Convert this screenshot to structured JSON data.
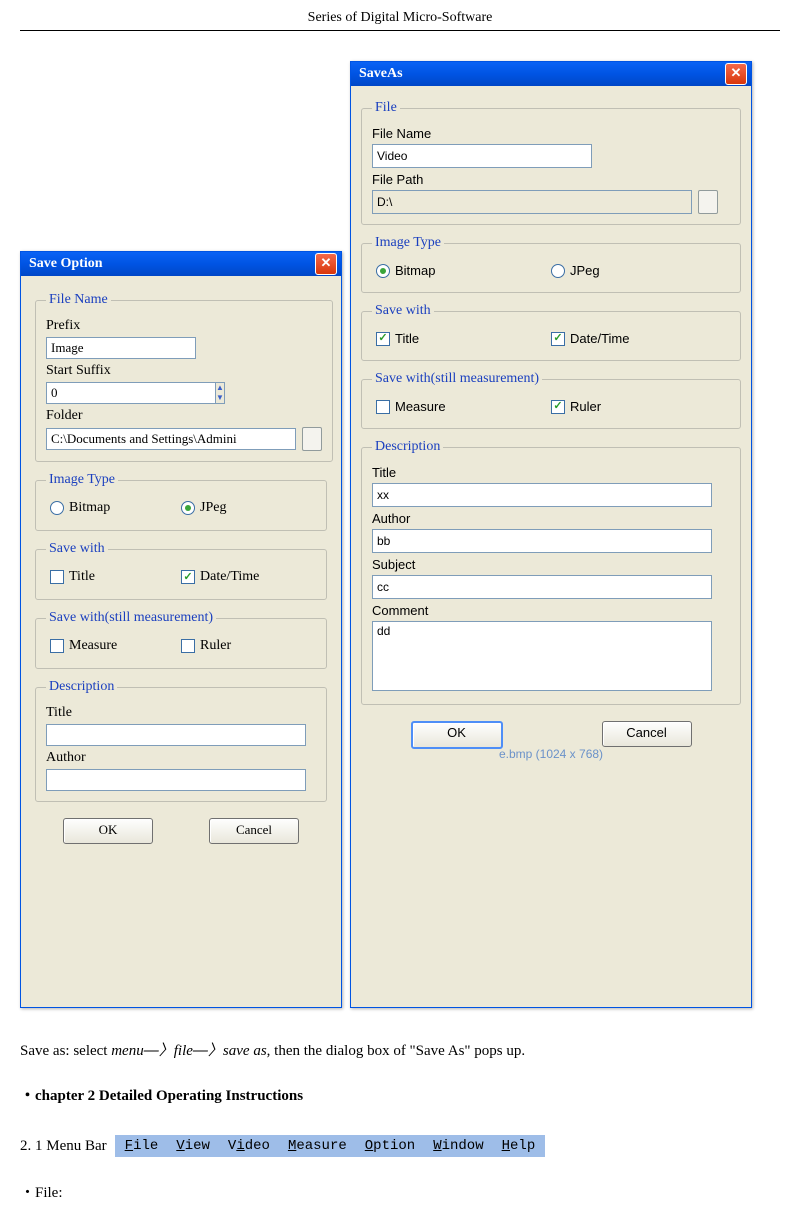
{
  "header": "Series of Digital Micro-Software",
  "dialog1": {
    "title": "Save Option",
    "file_name_group": "File Name",
    "prefix_label": "Prefix",
    "prefix_value": "Image",
    "start_suffix_label": "Start Suffix",
    "start_suffix_value": "0",
    "folder_label": "Folder",
    "folder_value": "C:\\Documents and Settings\\Admini",
    "image_type_group": "Image Type",
    "bitmap_label": "Bitmap",
    "jpeg_label": "JPeg",
    "save_with_group": "Save with",
    "title_check_label": "Title",
    "datetime_check_label": "Date/Time",
    "save_with_still_group": "Save with(still measurement)",
    "measure_label": "Measure",
    "ruler_label": "Ruler",
    "description_group": "Description",
    "desc_title_label": "Title",
    "desc_title_value": "",
    "desc_author_label": "Author",
    "desc_author_value": "",
    "ok": "OK",
    "cancel": "Cancel"
  },
  "dialog2": {
    "title": "SaveAs",
    "file_group": "File",
    "file_name_label": "File Name",
    "file_name_value": "Video",
    "file_path_label": "File Path",
    "file_path_value": "D:\\",
    "image_type_group": "Image Type",
    "bitmap_label": "Bitmap",
    "jpeg_label": "JPeg",
    "save_with_group": "Save with",
    "title_check_label": "Title",
    "datetime_check_label": "Date/Time",
    "save_with_still_group": "Save with(still measurement)",
    "measure_label": "Measure",
    "ruler_label": "Ruler",
    "description_group": "Description",
    "desc_title_label": "Title",
    "desc_title_value": "xx",
    "desc_author_label": "Author",
    "desc_author_value": "bb",
    "desc_subject_label": "Subject",
    "desc_subject_value": "cc",
    "desc_comment_label": "Comment",
    "desc_comment_value": "dd",
    "ok": "OK",
    "cancel": "Cancel",
    "status": "e.bmp (1024 x 768)"
  },
  "foot": {
    "line1a": "Save as: select ",
    "line1b": "menu",
    "line1c": "file",
    "line1d": "save as",
    "line1e": ", then the dialog box of \"Save As\" pops up.",
    "arrow": "—〉",
    "chapter": "・chapter 2 Detailed Operating Instructions",
    "menubar_label": "2. 1  Menu Bar",
    "menu_items": [
      "File",
      "View",
      "Video",
      "Measure",
      "Option",
      "Window",
      "Help"
    ],
    "file_line": "・File:"
  }
}
